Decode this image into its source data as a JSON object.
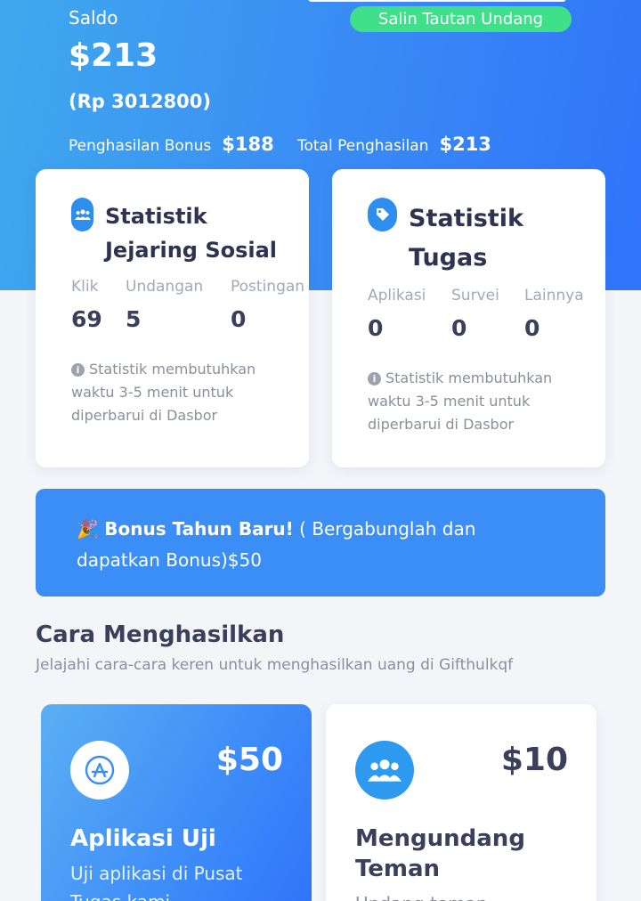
{
  "balance": {
    "label": "Saldo",
    "amount": "$213",
    "local_amount": "(Rp 3012800)",
    "invite_button": "Salin Tautan Undang",
    "bonus_label": "Penghasilan Bonus",
    "bonus_value": "$188",
    "total_label": "Total Penghasilan",
    "total_value": "$213"
  },
  "social_stats": {
    "icon": "users-icon",
    "title_line1": "Statistik",
    "title_line2": "Jejaring Sosial",
    "columns": [
      {
        "label": "Klik",
        "value": "69"
      },
      {
        "label": "Undangan",
        "value": "5"
      },
      {
        "label": "Postingan",
        "value": "0"
      }
    ],
    "note": "Statistik membutuhkan waktu 3-5 menit untuk diperbarui di Dasbor"
  },
  "task_stats": {
    "icon": "tag-icon",
    "title_line1": "Statistik",
    "title_line2": "Tugas",
    "columns": [
      {
        "label": "Aplikasi",
        "value": "0"
      },
      {
        "label": "Survei",
        "value": "0"
      },
      {
        "label": "Lainnya",
        "value": "0"
      }
    ],
    "note": "Statistik membutuhkan waktu 3-5 menit untuk diperbarui di Dasbor"
  },
  "bonus_banner": {
    "emoji": "🎉",
    "title": "Bonus Tahun Baru!",
    "text": " ( Bergabunglah dan dapatkan Bonus)$50"
  },
  "how_to_earn": {
    "title": "Cara Menghasilkan",
    "subtitle": "Jelajahi cara-cara keren untuk menghasilkan uang di Gifthulkqf",
    "cards": [
      {
        "icon": "app-store-icon",
        "amount": "$50",
        "title": "Aplikasi Uji",
        "desc": "Uji aplikasi di Pusat Tugas kami"
      },
      {
        "icon": "users-icon",
        "amount": "$10",
        "title_line1": "Mengundang",
        "title_line2": "Teman",
        "desc": "Undang teman"
      }
    ]
  },
  "colors": {
    "accent_blue": "#2f74fa",
    "invite_green": "#3ee08a",
    "heading": "#3a3f5c"
  }
}
